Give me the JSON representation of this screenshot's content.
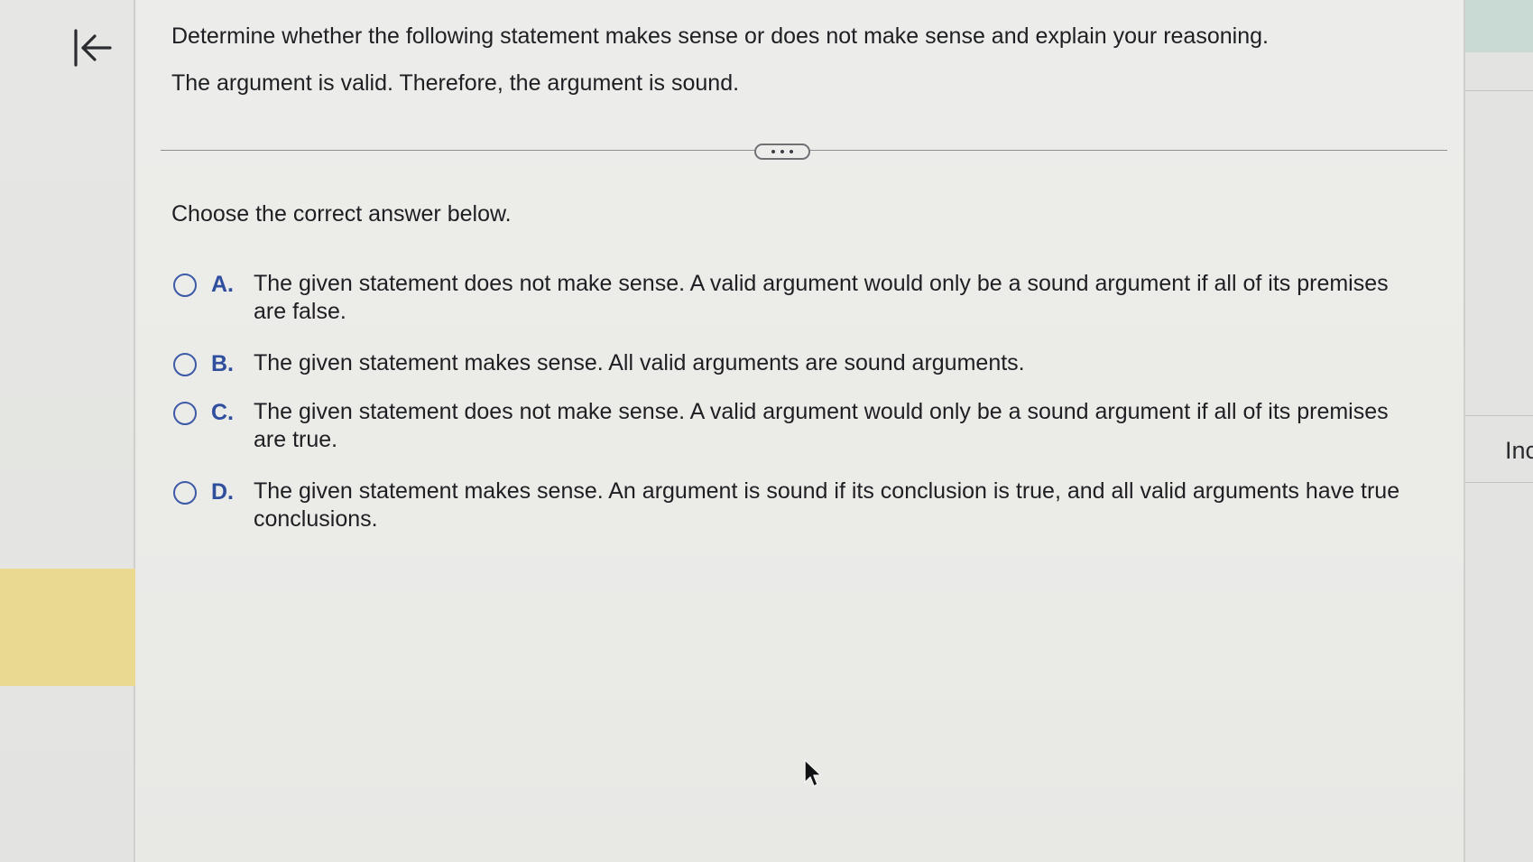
{
  "question": {
    "header": "Determine whether the following statement makes sense or does not make sense and explain your reasoning.",
    "statement": "The argument is valid. Therefore, the argument is sound."
  },
  "instruction": "Choose the correct answer below.",
  "options": [
    {
      "letter": "A.",
      "text": "The given statement does not make sense. A valid argument would only be a sound argument if all of its premises are false."
    },
    {
      "letter": "B.",
      "text": "The given statement makes sense. All valid arguments are sound arguments."
    },
    {
      "letter": "C.",
      "text": "The given statement does not make sense. A valid argument would only be a sound argument if all of its premises are true."
    },
    {
      "letter": "D.",
      "text": "The given statement makes sense. An argument is sound if its conclusion is true, and all valid arguments have true conclusions."
    }
  ],
  "right_panel": {
    "tab_label": "Inc"
  },
  "icons": {
    "collapse": "collapse-left-icon",
    "expand": "more-dots-icon",
    "cursor": "mouse-pointer-icon"
  },
  "colors": {
    "accent": "#2f4f9e",
    "radio_border": "#3d5aa6",
    "highlight": "#ead990",
    "top_strip": "#c9dad5"
  }
}
